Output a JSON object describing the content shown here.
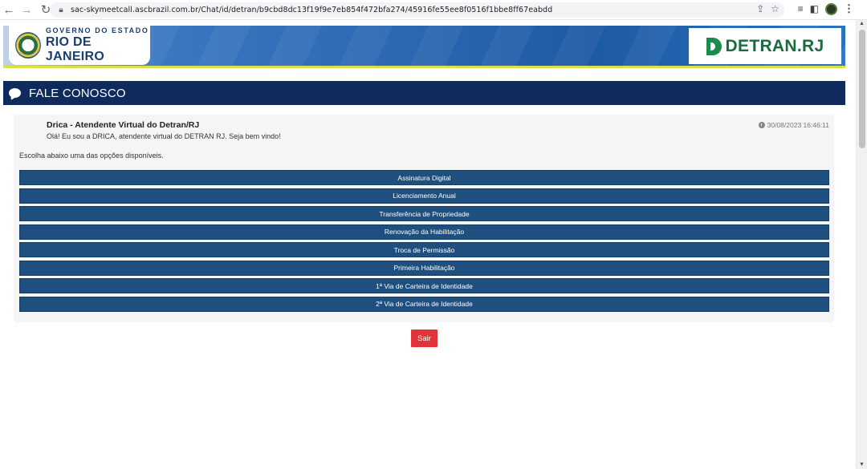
{
  "browser": {
    "url": "sac-skymeetcall.ascbrazil.com.br/Chat/id/detran/b9cbd8dc13f19f9e7eb854f472bfa274/45916fe55ee8f0516f1bbe8ff67eabdd"
  },
  "header": {
    "gov_line1": "GOVERNO DO ESTADO",
    "gov_line2": "RIO DE JANEIRO",
    "detran_brand": "DETRAN.RJ"
  },
  "section": {
    "title": "FALE CONOSCO"
  },
  "chat": {
    "agent_name": "Drica - Atendente Virtual do Detran/RJ",
    "greeting": "Olá! Eu sou a DRICA, atendente virtual do DETRAN RJ. Seja bem vindo!",
    "timestamp": "30/08/2023 16:46:11",
    "prompt": "Escolha abaixo uma das opções disponíveis.",
    "options": [
      "Assinatura Digital",
      "Licenciamento Anual",
      "Transferência de Propriedade",
      "Renovação da Habilitação",
      "Troca de Permissão",
      "Primeira Habilitação",
      "1ª Via de Carteira de Identidade",
      "2ª Via de Carteira de Identidade"
    ]
  },
  "actions": {
    "exit_label": "Sair"
  },
  "colors": {
    "section_bar": "#0f2a5c",
    "option_button": "#1f4f7e",
    "exit_button": "#e0343a",
    "detran_green": "#1b6b3f"
  }
}
